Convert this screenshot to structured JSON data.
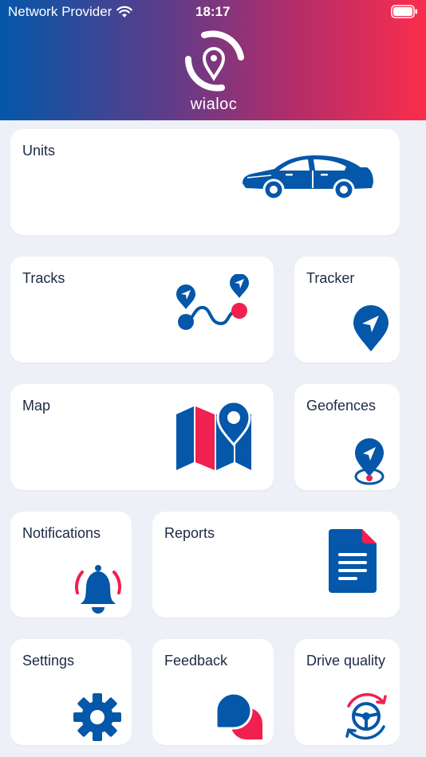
{
  "status_bar": {
    "carrier": "Network Provider",
    "time": "18:17",
    "wifi_icon": "wifi-icon",
    "battery_icon": "battery-icon"
  },
  "brand": {
    "name": "wialoc",
    "logo_icon": "wialoc-logo-icon"
  },
  "tiles": {
    "units": {
      "label": "Units",
      "icon": "car-icon"
    },
    "tracks": {
      "label": "Tracks",
      "icon": "route-icon"
    },
    "tracker": {
      "label": "Tracker",
      "icon": "navigation-pin-icon"
    },
    "map": {
      "label": "Map",
      "icon": "map-icon"
    },
    "geofences": {
      "label": "Geofences",
      "icon": "geofence-pin-icon"
    },
    "notifications": {
      "label": "Notifications",
      "icon": "bell-icon"
    },
    "reports": {
      "label": "Reports",
      "icon": "document-icon"
    },
    "settings": {
      "label": "Settings",
      "icon": "gear-icon"
    },
    "feedback": {
      "label": "Feedback",
      "icon": "chat-bubbles-icon"
    },
    "drive_quality": {
      "label": "Drive quality",
      "icon": "steering-wheel-icon"
    }
  },
  "colors": {
    "primary_blue": "#0457a9",
    "accent_red": "#f0204f",
    "label_text": "#1c2a45",
    "background": "#eef0f7",
    "tile_background": "#ffffff"
  }
}
